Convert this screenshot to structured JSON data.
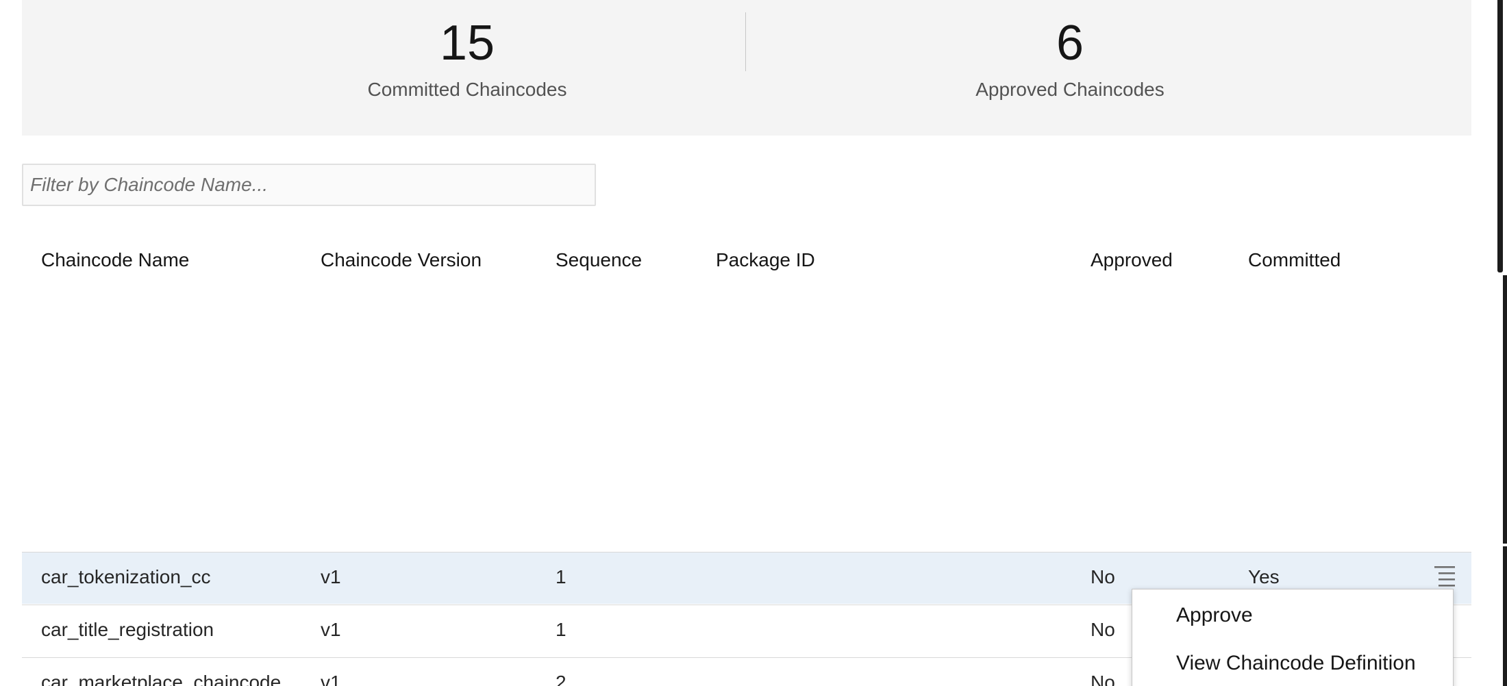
{
  "summary": {
    "committed_count": "15",
    "committed_label": "Committed Chaincodes",
    "approved_count": "6",
    "approved_label": "Approved Chaincodes"
  },
  "filter": {
    "placeholder": "Filter by Chaincode Name...",
    "value": ""
  },
  "table": {
    "headers": {
      "name": "Chaincode Name",
      "version": "Chaincode Version",
      "sequence": "Sequence",
      "package_id": "Package ID",
      "approved": "Approved",
      "committed": "Committed"
    },
    "rows": [
      {
        "name": "car_tokenization_cc",
        "version": "v1",
        "sequence": "1",
        "package_id": "",
        "approved": "No",
        "committed": "Yes",
        "highlighted": true
      },
      {
        "name": "car_title_registration",
        "version": "v1",
        "sequence": "1",
        "package_id": "",
        "approved": "No",
        "committed": "",
        "highlighted": false
      },
      {
        "name": "car_marketplace_chaincode",
        "version": "v1",
        "sequence": "2",
        "package_id": "",
        "approved": "No",
        "committed": "",
        "highlighted": false
      }
    ]
  },
  "row_menu": {
    "icon": "overflow-menu-icon",
    "items": [
      "Approve",
      "View Chaincode Definition"
    ]
  },
  "colors": {
    "summary_bg": "#f4f4f4",
    "row_highlight": "#e8f0f8",
    "border": "#d8d8d8"
  }
}
